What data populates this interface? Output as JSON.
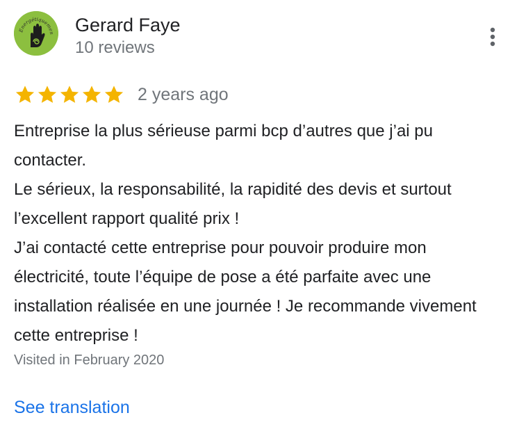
{
  "reviewer": {
    "name": "Gerard Faye",
    "review_count": "10 reviews",
    "avatar_text": "Energétiquement"
  },
  "menu_icon": "more-vert-icon",
  "rating": {
    "stars": 5,
    "max": 5,
    "star_color": "#f4b400",
    "time_ago": "2 years ago"
  },
  "review": {
    "paragraphs": [
      "Entreprise la plus sérieuse parmi bcp d’autres que j’ai pu contacter.",
      "Le sérieux, la responsabilité, la rapidité des devis et surtout l’excellent rapport qualité prix !",
      "J’ai contacté cette entreprise pour pouvoir produire mon électricité, toute l’équipe de pose a été parfaite avec une installation réalisée en une journée ! Je recommande vivement cette entreprise !"
    ]
  },
  "visited": "Visited in February 2020",
  "see_translation": "See translation",
  "colors": {
    "link": "#1a73e8",
    "secondary_text": "#70757a",
    "avatar_bg": "#8cbf3f"
  }
}
